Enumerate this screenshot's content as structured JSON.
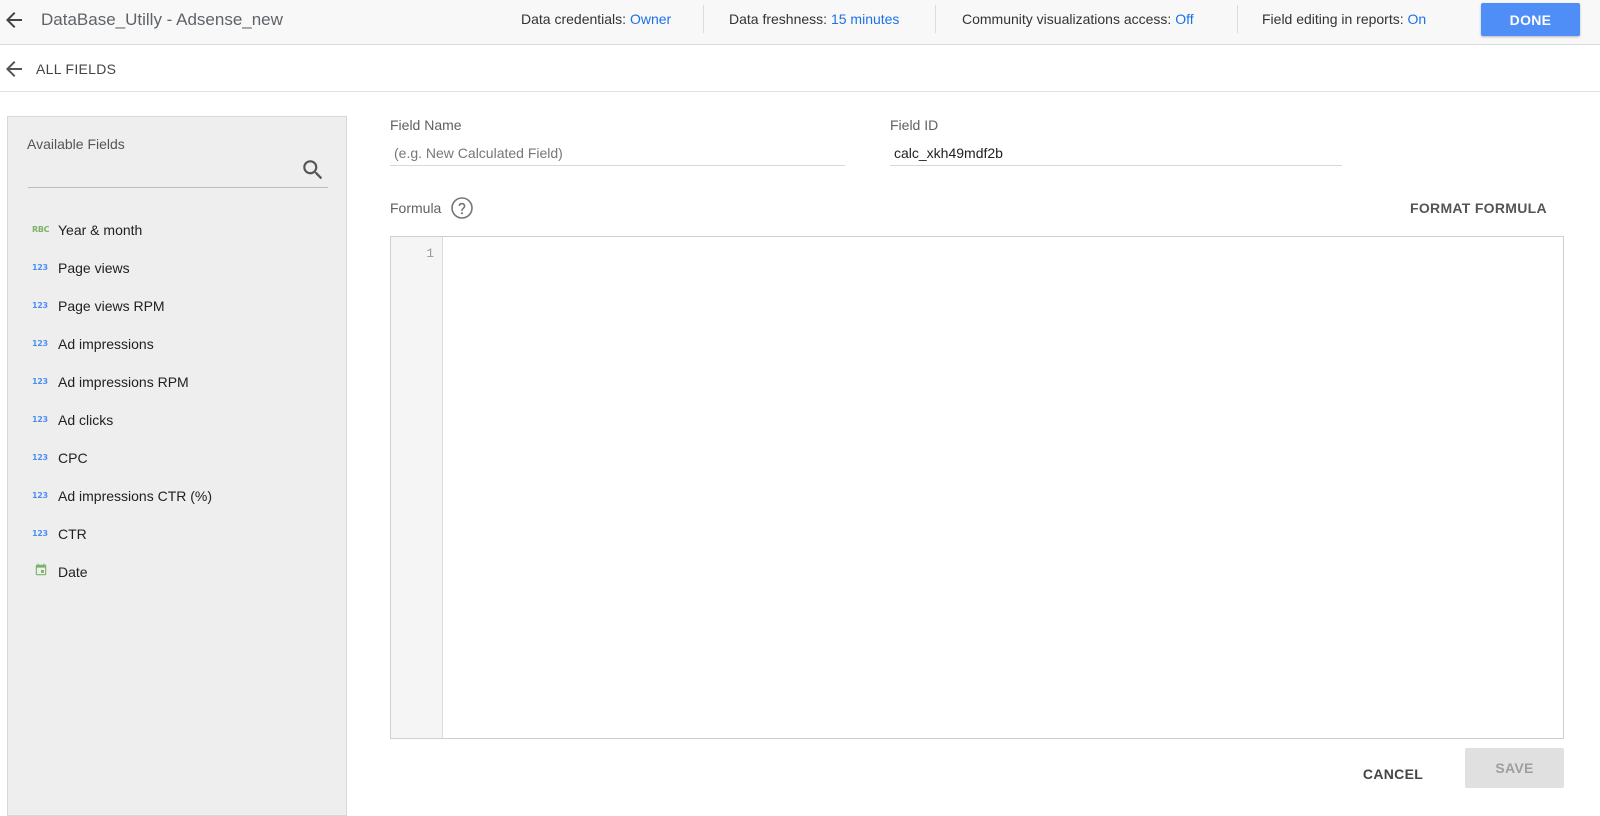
{
  "header": {
    "title": "DataBase_Utilly - Adsense_new",
    "credentials_label": "Data credentials:",
    "credentials_value": "Owner",
    "freshness_label": "Data freshness:",
    "freshness_value": "15 minutes",
    "community_label": "Community visualizations access:",
    "community_value": "Off",
    "editing_label": "Field editing in reports:",
    "editing_value": "On",
    "done_label": "DONE",
    "back_icon": "arrow-left-icon"
  },
  "subheader": {
    "label": "ALL FIELDS",
    "back_icon": "arrow-left-icon"
  },
  "sidebar": {
    "heading": "Available Fields",
    "search_icon": "search-icon",
    "fields": [
      {
        "type": "abc",
        "label": "Year & month"
      },
      {
        "type": "number",
        "label": "Page views"
      },
      {
        "type": "number",
        "label": "Page views RPM"
      },
      {
        "type": "number",
        "label": "Ad impressions"
      },
      {
        "type": "number",
        "label": "Ad impressions RPM"
      },
      {
        "type": "number",
        "label": "Ad clicks"
      },
      {
        "type": "number",
        "label": "CPC"
      },
      {
        "type": "number",
        "label": "Ad impressions CTR (%)"
      },
      {
        "type": "number",
        "label": "CTR"
      },
      {
        "type": "date",
        "label": "Date"
      }
    ]
  },
  "form": {
    "field_name_label": "Field Name",
    "field_name_placeholder": "(e.g. New Calculated Field)",
    "field_name_value": "",
    "field_id_label": "Field ID",
    "field_id_value": "calc_xkh49mdf2b",
    "formula_label": "Formula",
    "help_icon": "help-circle-icon",
    "format_label": "FORMAT FORMULA",
    "line_number": "1",
    "cancel_label": "CANCEL",
    "save_label": "SAVE"
  },
  "icon_glyphs": {
    "abc": "RBC",
    "number": "123"
  },
  "colors": {
    "accent": "#1a73e8",
    "done_button": "#4f8ef7",
    "abc_icon": "#7cb36a",
    "number_icon": "#4f8ef7",
    "date_icon": "#7cb36a"
  }
}
